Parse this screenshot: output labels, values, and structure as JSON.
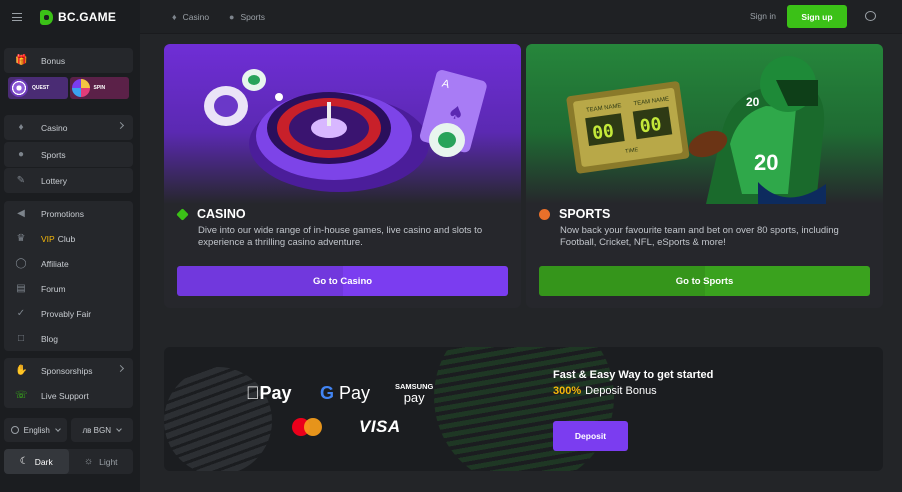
{
  "brand": {
    "name": "BC.GAME"
  },
  "header": {
    "nav": [
      {
        "label": "Casino",
        "icon": "casino-icon"
      },
      {
        "label": "Sports",
        "icon": "sports-ball-icon"
      }
    ],
    "signin_label": "Sign in",
    "signup_label": "Sign up"
  },
  "sidebar": {
    "bonus_label": "Bonus",
    "quest_label": "QUEST",
    "spin_label": "SPIN",
    "games": [
      {
        "label": "Casino",
        "icon": "casino-icon",
        "has_chevron": true
      },
      {
        "label": "Sports",
        "icon": "sports-ball-icon"
      },
      {
        "label": "Lottery",
        "icon": "lottery-ticket-icon"
      }
    ],
    "links": [
      {
        "label": "Promotions",
        "icon": "megaphone-icon"
      },
      {
        "label_accent": "VIP",
        "label": "Club",
        "icon": "crown-icon"
      },
      {
        "label": "Affiliate",
        "icon": "affiliate-icon"
      },
      {
        "label": "Forum",
        "icon": "forum-icon"
      },
      {
        "label": "Provably Fair",
        "icon": "shield-check-icon"
      },
      {
        "label": "Blog",
        "icon": "blog-icon"
      }
    ],
    "support": [
      {
        "label": "Sponsorships",
        "icon": "handshake-icon",
        "has_chevron": true
      },
      {
        "label": "Live Support",
        "icon": "headset-icon"
      }
    ],
    "language": "English",
    "currency": "лв BGN",
    "theme_dark": "Dark",
    "theme_light": "Light"
  },
  "cards": {
    "casino": {
      "title": "CASINO",
      "description": "Dive into our wide range of in-house games, live casino and slots to experience a thrilling casino adventure.",
      "cta": "Go to Casino"
    },
    "sports": {
      "title": "SPORTS",
      "description": "Now back your favourite team and bet on over 80 sports, including Football, Cricket, NFL, eSports & more!",
      "cta": "Go to Sports",
      "scoreboard": {
        "team_left": "TEAM NAME",
        "team_right": "TEAM NAME",
        "score_left": "00",
        "score_right": "00",
        "time_label": "TIME",
        "jersey_number": "20"
      }
    }
  },
  "banner": {
    "apple_pay": "Pay",
    "google_pay": "Pay",
    "samsung_top": "SAMSUNG",
    "samsung_bottom": "pay",
    "visa": "VISA",
    "title": "Fast & Easy Way to get started",
    "bonus_pct": "300%",
    "bonus_text": "Deposit Bonus",
    "deposit_label": "Deposit"
  },
  "colors": {
    "brand_green": "#3bc117",
    "accent_purple": "#7b3df0",
    "vip_gold": "#f5b70a"
  }
}
